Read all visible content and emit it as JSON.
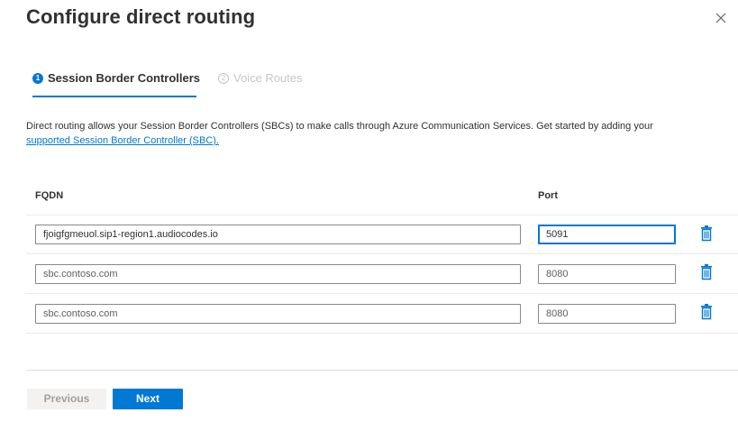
{
  "panel": {
    "title": "Configure direct routing",
    "close_icon": "close-icon"
  },
  "tabs": [
    {
      "number": "1",
      "label": "Session Border Controllers",
      "state": "active"
    },
    {
      "number": "2",
      "label": "Voice Routes",
      "state": "disabled"
    }
  ],
  "description": {
    "text": "Direct routing allows your Session Border Controllers (SBCs) to make calls through Azure Communication Services. Get started by adding your ",
    "link": "supported Session Border Controller (SBC)."
  },
  "table": {
    "headers": {
      "fqdn": "FQDN",
      "port": "Port"
    },
    "rows": [
      {
        "fqdn_value": "fjoigfgmeuol.sip1-region1.audiocodes.io",
        "fqdn_placeholder": "",
        "port_value": "5091",
        "port_placeholder": "",
        "delete_icon": "trash-icon"
      },
      {
        "fqdn_value": "",
        "fqdn_placeholder": "sbc.contoso.com",
        "port_value": "",
        "port_placeholder": "8080",
        "delete_icon": "trash-icon"
      },
      {
        "fqdn_value": "",
        "fqdn_placeholder": "sbc.contoso.com",
        "port_value": "",
        "port_placeholder": "8080",
        "delete_icon": "trash-icon"
      }
    ]
  },
  "footer": {
    "previous_label": "Previous",
    "next_label": "Next"
  },
  "colors": {
    "accent": "#0078d4",
    "text": "#323130",
    "disabled": "#c8c6c4",
    "border": "#8a8886"
  }
}
